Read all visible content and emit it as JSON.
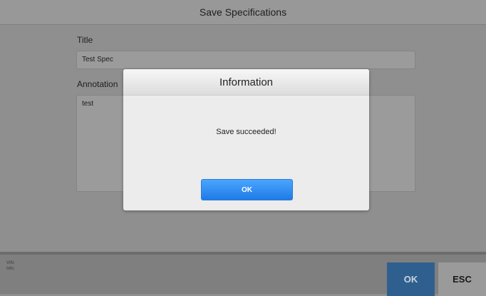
{
  "window": {
    "title": "Save Specifications"
  },
  "form": {
    "title_label": "Title",
    "title_value": "Test Spec",
    "annotation_label": "Annotation",
    "annotation_value": "test"
  },
  "footer": {
    "vin_label": "VIN:",
    "info_label": "Info:",
    "ok_label": "OK",
    "esc_label": "ESC"
  },
  "dialog": {
    "title": "Information",
    "message": "Save succeeded!",
    "ok_label": "OK"
  },
  "colors": {
    "dialog_button": "#1e7be6",
    "footer_ok": "#2f5f8f"
  }
}
